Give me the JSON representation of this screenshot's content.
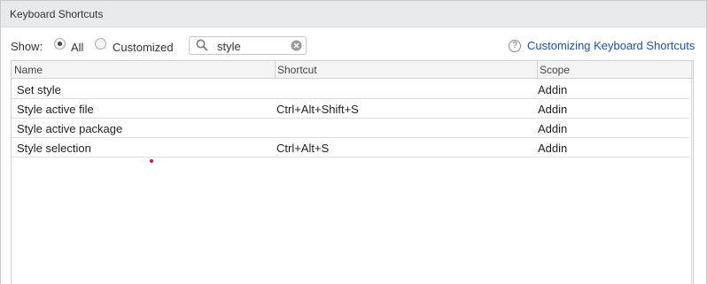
{
  "dialog": {
    "title": "Keyboard Shortcuts"
  },
  "filter": {
    "show_label": "Show:",
    "options": [
      {
        "label": "All",
        "selected": true
      },
      {
        "label": "Customized",
        "selected": false
      }
    ],
    "search_value": "style"
  },
  "help": {
    "link_text": "Customizing Keyboard Shortcuts"
  },
  "table": {
    "columns": [
      "Name",
      "Shortcut",
      "Scope"
    ],
    "rows": [
      {
        "name": "Set style",
        "shortcut": "",
        "scope": "Addin"
      },
      {
        "name": "Style active file",
        "shortcut": "Ctrl+Alt+Shift+S",
        "scope": "Addin"
      },
      {
        "name": "Style active package",
        "shortcut": "",
        "scope": "Addin"
      },
      {
        "name": "Style selection",
        "shortcut": "Ctrl+Alt+S",
        "scope": "Addin"
      }
    ]
  },
  "icons": [
    "search-icon",
    "clear-icon",
    "help-icon"
  ],
  "colors": {
    "link": "#2150a8",
    "header_bg": "#f5f5f5",
    "titlebar_bg": "#e9eaec"
  }
}
